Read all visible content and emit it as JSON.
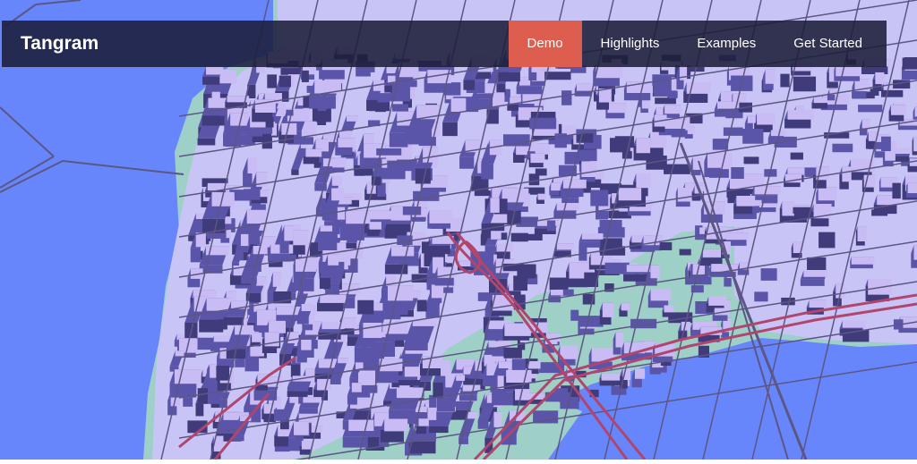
{
  "brand": "Tangram",
  "nav": {
    "items": [
      {
        "label": "Demo",
        "active": true
      },
      {
        "label": "Highlights",
        "active": false
      },
      {
        "label": "Examples",
        "active": false
      },
      {
        "label": "Get Started",
        "active": false
      }
    ]
  },
  "map": {
    "colors": {
      "water": "#6786fb",
      "land": "#9fd0c8",
      "street_block": "#c8c4f5",
      "building_top": "#c9bcf4",
      "building_side": "#5a55a8",
      "building_dark": "#403b7a",
      "street_line": "#5b5683",
      "highway": "#b0456d",
      "nav_active": "#dd5e4e"
    }
  }
}
